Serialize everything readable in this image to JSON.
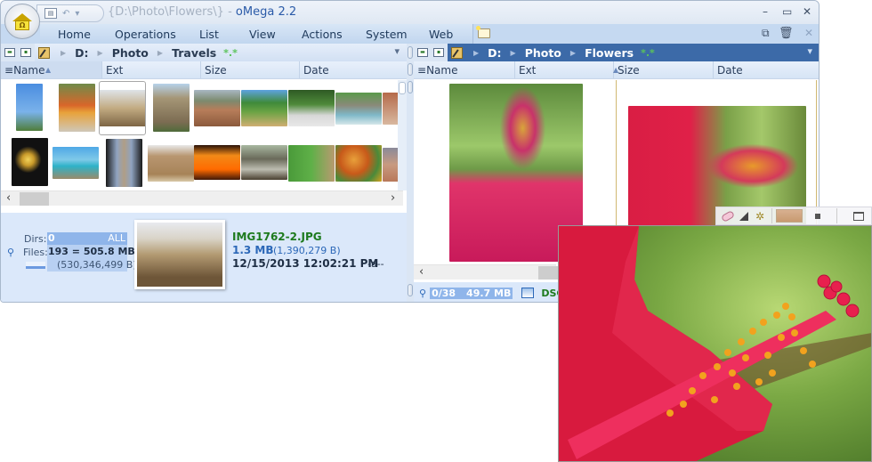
{
  "window": {
    "title_path": "{D:\\Photo\\Flowers\\}",
    "title_sep": " - ",
    "app_name": "oMega 2.2",
    "controls": {
      "minimize": "–",
      "maximize": "▭",
      "close": "✕"
    },
    "orb_glyph": "Ω"
  },
  "quick_access": {
    "icons": [
      "layout-icon",
      "undo-icon",
      "dropdown-icon"
    ],
    "undo": "↶",
    "dropdown": "▾"
  },
  "ribbon": {
    "tabs": [
      "Home",
      "Operations",
      "List",
      "View",
      "Actions",
      "System",
      "Web"
    ],
    "right_icons": {
      "link": "⧉",
      "recycle": "🗑",
      "close": "✕"
    }
  },
  "left_panel": {
    "path": {
      "drive": "D:",
      "crumbs": [
        "Photo",
        "Travels"
      ],
      "mask": "*.*"
    },
    "columns": [
      "Name",
      "Ext",
      "Size",
      "Date"
    ],
    "sort_column": "Name",
    "thumbnails": [
      {
        "subject": "leaning-tower"
      },
      {
        "subject": "buddha-shrine"
      },
      {
        "subject": "pyramid-sphinx",
        "selected": true
      },
      {
        "subject": "castle-towers"
      },
      {
        "subject": "mountain-house"
      },
      {
        "subject": "palm-garden"
      },
      {
        "subject": "forest-path"
      },
      {
        "subject": "river-bridge"
      },
      {
        "subject": "rocks"
      },
      {
        "subject": "eiffel-tower-night"
      },
      {
        "subject": "sea-rock"
      },
      {
        "subject": "cathedral-spires"
      },
      {
        "subject": "ruins"
      },
      {
        "subject": "fountain-lights"
      },
      {
        "subject": "tree-roots"
      },
      {
        "subject": "village-path"
      },
      {
        "subject": "autumn-leaves"
      },
      {
        "subject": "desert-rocks"
      }
    ],
    "info": {
      "dirs_label": "Dirs:",
      "dirs_value": "0",
      "filter": "ALL",
      "files_label": "Files:",
      "files_value": "193 = 505.8 MB",
      "files_bytes": "(530,346,499 B)",
      "selected_file": {
        "name": "IMG1762-2.JPG",
        "size": "1.3 MB",
        "bytes": "(1,390,279 B)",
        "datetime": "12/15/2013 12:02:21 PM",
        "attributes": "-a--"
      }
    }
  },
  "right_panel": {
    "path": {
      "drive": "D:",
      "crumbs": [
        "Photo",
        "Flowers"
      ],
      "mask": "*.*"
    },
    "columns": [
      "Name",
      "Ext",
      "Size",
      "Date"
    ],
    "sort_column": "Size",
    "status": {
      "count": "0/38",
      "size": "49.7 MB",
      "file_prefix": "DSC"
    }
  },
  "preview_toolbar": {
    "icons": [
      "eraser-icon",
      "triangle-icon",
      "tools-icon",
      "color-swatch",
      "stop-icon",
      "window-icon"
    ]
  },
  "colors": {
    "accent": "#3c6aa8",
    "ribbon": "#c5d9f1",
    "panel_bg": "#dbe8fa",
    "filename_green": "#1d7a1d",
    "size_blue": "#2c68b8"
  }
}
